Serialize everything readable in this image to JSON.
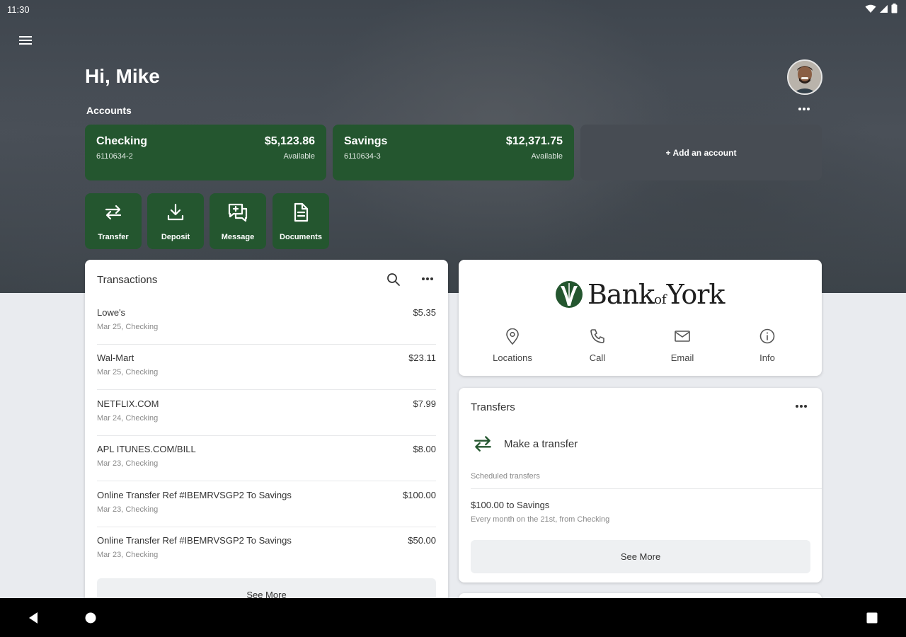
{
  "status_bar": {
    "time": "11:30"
  },
  "header": {
    "greeting": "Hi, Mike"
  },
  "accounts": {
    "label": "Accounts",
    "items": [
      {
        "name": "Checking",
        "number": "6110634-2",
        "balance": "$5,123.86",
        "balance_label": "Available"
      },
      {
        "name": "Savings",
        "number": "6110634-3",
        "balance": "$12,371.75",
        "balance_label": "Available"
      }
    ],
    "add_label": "+ Add an account"
  },
  "quick_actions": [
    {
      "label": "Transfer",
      "icon": "transfer-icon"
    },
    {
      "label": "Deposit",
      "icon": "download-icon"
    },
    {
      "label": "Message",
      "icon": "message-icon"
    },
    {
      "label": "Documents",
      "icon": "document-icon"
    }
  ],
  "transactions": {
    "title": "Transactions",
    "items": [
      {
        "merchant": "Lowe's",
        "detail": "Mar 25, Checking",
        "amount": "$5.35"
      },
      {
        "merchant": "Wal-Mart",
        "detail": "Mar 25, Checking",
        "amount": "$23.11"
      },
      {
        "merchant": "NETFLIX.COM",
        "detail": "Mar 24, Checking",
        "amount": "$7.99"
      },
      {
        "merchant": "APL ITUNES.COM/BILL",
        "detail": "Mar 23, Checking",
        "amount": "$8.00"
      },
      {
        "merchant": "Online Transfer Ref #IBEMRVSGP2 To Savings",
        "detail": "Mar 23, Checking",
        "amount": "$100.00"
      },
      {
        "merchant": "Online Transfer Ref #IBEMRVSGP2 To Savings",
        "detail": "Mar 23, Checking",
        "amount": "$50.00"
      }
    ],
    "see_more": "See More"
  },
  "bank": {
    "logo_word_1": "Bank",
    "logo_word_of": "of",
    "logo_word_2": "York",
    "contacts": [
      {
        "label": "Locations",
        "icon": "location-pin-icon"
      },
      {
        "label": "Call",
        "icon": "phone-icon"
      },
      {
        "label": "Email",
        "icon": "email-icon"
      },
      {
        "label": "Info",
        "icon": "info-icon"
      }
    ]
  },
  "transfers": {
    "title": "Transfers",
    "make_transfer": "Make a transfer",
    "scheduled_label": "Scheduled transfers",
    "scheduled": [
      {
        "title": "$100.00 to Savings",
        "subtitle": "Every month on the 21st, from Checking"
      }
    ],
    "see_more": "See More"
  },
  "colors": {
    "brand_green": "#24562f",
    "hero_dark": "#3f464e",
    "page_bg": "#e9ebef"
  }
}
